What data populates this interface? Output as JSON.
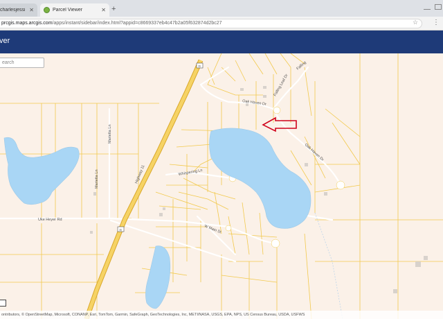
{
  "browser": {
    "tabs": [
      {
        "title": "charlesjessicnassel1",
        "active": false
      },
      {
        "title": "Parcel Viewer",
        "active": true
      }
    ],
    "new_tab": "+",
    "url_host": "prcgis.maps.arcgis.com",
    "url_path": "/apps/instant/sidebar/index.html?appid=c8669337eb4c47b2a05f632874d2bc27"
  },
  "app": {
    "title": "ver"
  },
  "search": {
    "placeholder": "earch"
  },
  "map": {
    "street_labels": [
      "Oak Haven Dr",
      "Oak Haven Dr",
      "Falling Leaf Dr",
      "Falling",
      "Whispering Ln",
      "Marietta Ln",
      "Marietta Ln",
      "Highway 11",
      "Uke Heyer Rd",
      "W Main St"
    ],
    "route_shields": [
      "11",
      "11"
    ],
    "attribution": "ontributors, © OpenStreetMap, Microsoft, CONANP, Esri, TomTom, Garmin, SafeGraph, GeoTechnologies, Inc, METI/NASA, USGS, EPA, NPS, US Census Bureau, USDA, USFWS",
    "colors": {
      "background": "#fbf1e8",
      "water": "#a9d6f5",
      "parcel_lines": "#f2c94c",
      "highway": "#f6d365",
      "highway_edge": "#d9a72a",
      "annotation_arrow": "#d0021b"
    }
  }
}
